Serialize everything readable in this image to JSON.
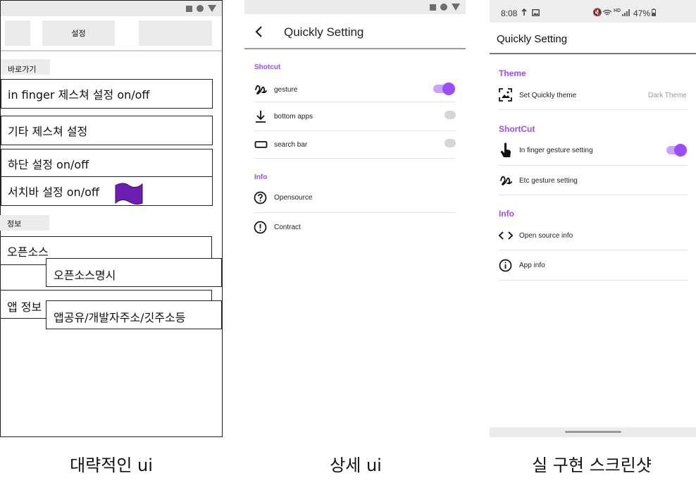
{
  "colors": {
    "accent": "#9b4dff",
    "accent_light": "#caa3ff",
    "flag": "#6a1fb0",
    "toggle_off": "#d6d6d6"
  },
  "wireframe": {
    "header_title": "설정",
    "shortcut_label": "바로가기",
    "items": [
      "in finger 제스쳐 설정 on/off",
      "기타 제스쳐 설정",
      "하단 설정 on/off",
      "서치바 설정 on/off"
    ],
    "info_label": "정보",
    "opensource": "오픈소스",
    "opensource_note": "오픈소스명시",
    "appinfo": "앱 정보",
    "appinfo_note": "앱공유/개발자주소/깃주소등"
  },
  "detail": {
    "title": "Quickly Setting",
    "shortcut_section": "Shotcut",
    "shortcut_items": [
      {
        "label": "gesture",
        "icon": "gesture-icon",
        "toggle": true
      },
      {
        "label": "bottom apps",
        "icon": "download-icon",
        "toggle": false
      },
      {
        "label": "search bar",
        "icon": "search-bar-icon",
        "toggle": false
      }
    ],
    "info_section": "Info",
    "info_items": [
      {
        "label": "Opensource",
        "icon": "help-circle-icon"
      },
      {
        "label": "Contract",
        "icon": "alert-circle-icon"
      }
    ]
  },
  "real": {
    "status": {
      "time": "8:08",
      "battery": "47%"
    },
    "title": "Quickly Setting",
    "theme_section": "Theme",
    "theme_item": {
      "label": "Set Quickly theme",
      "value": "Dark Theme",
      "icon": "wallpaper-icon"
    },
    "shortcut_section": "ShortCut",
    "shortcut_items": [
      {
        "label": "In finger gesture setting",
        "icon": "touch-icon",
        "toggle": true
      },
      {
        "label": "Etc gesture setting",
        "icon": "gesture-icon"
      }
    ],
    "info_section": "Info",
    "info_items": [
      {
        "label": "Open source info",
        "icon": "code-icon"
      },
      {
        "label": "App info",
        "icon": "info-icon"
      }
    ]
  },
  "captions": [
    "대략적인 ui",
    "상세 ui",
    "실 구현 스크린샷"
  ]
}
